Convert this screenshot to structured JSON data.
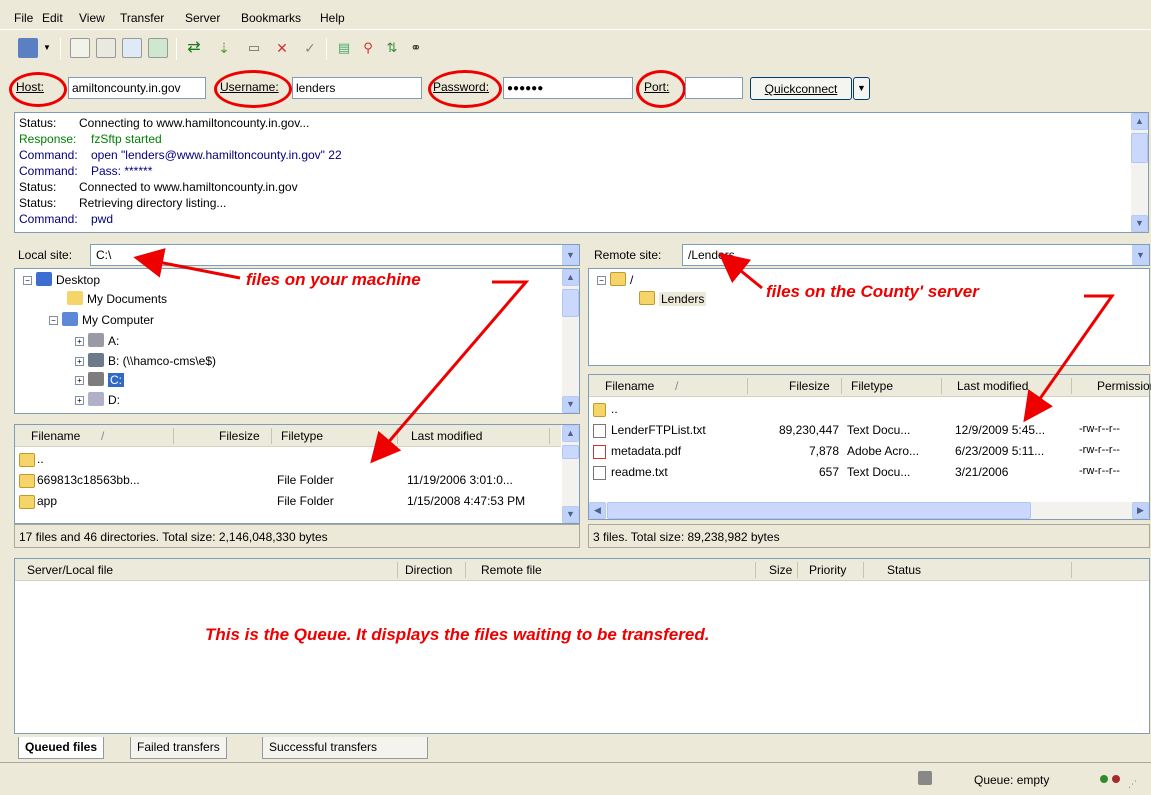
{
  "menu": [
    "File",
    "Edit",
    "View",
    "Transfer",
    "Server",
    "Bookmarks",
    "Help"
  ],
  "quickconnect": {
    "host_label": "Host:",
    "host_value": "amiltoncounty.in.gov",
    "username_label": "Username:",
    "username_value": "lenders",
    "password_label": "Password:",
    "password_value": "●●●●●●",
    "port_label": "Port:",
    "port_value": "",
    "button_label": "Quickconnect"
  },
  "log": [
    {
      "type": "Status:",
      "msg": "Connecting to www.hamiltoncounty.in.gov...",
      "color": "#000000"
    },
    {
      "type": "Response:",
      "msg": "fzSftp started",
      "color": "#008000"
    },
    {
      "type": "Command:",
      "msg": "open \"lenders@www.hamiltoncounty.in.gov\" 22",
      "color": "#000080"
    },
    {
      "type": "Command:",
      "msg": "Pass: ******",
      "color": "#000080"
    },
    {
      "type": "Status:",
      "msg": "Connected to www.hamiltoncounty.in.gov",
      "color": "#000000"
    },
    {
      "type": "Status:",
      "msg": "Retrieving directory listing...",
      "color": "#000000"
    },
    {
      "type": "Command:",
      "msg": "pwd",
      "color": "#000080"
    }
  ],
  "local": {
    "site_label": "Local site:",
    "path": "C:\\",
    "tree": [
      {
        "label": "Desktop",
        "icon": "desktop-icon"
      },
      {
        "label": "My Documents",
        "icon": "documents-folder-icon"
      },
      {
        "label": "My Computer",
        "icon": "computer-icon"
      },
      {
        "label": "A:",
        "icon": "floppy-drive-icon"
      },
      {
        "label": "B: (\\\\hamco-cms\\e$)",
        "icon": "network-drive-icon"
      },
      {
        "label": "C:",
        "icon": "hard-drive-icon"
      },
      {
        "label": "D:",
        "icon": "cd-drive-icon"
      }
    ],
    "headers": {
      "filename": "Filename",
      "sort": "/",
      "filesize": "Filesize",
      "filetype": "Filetype",
      "modified": "Last modified"
    },
    "files": [
      {
        "name": "..",
        "size": "",
        "type": "",
        "modified": ""
      },
      {
        "name": "669813c18563bb...",
        "size": "",
        "type": "File Folder",
        "modified": "11/19/2006 3:01:0..."
      },
      {
        "name": "app",
        "size": "",
        "type": "File Folder",
        "modified": "1/15/2008 4:47:53 PM"
      }
    ],
    "summary": "17 files and 46 directories. Total size: 2,146,048,330 bytes"
  },
  "remote": {
    "site_label": "Remote site:",
    "path": "/Lenders",
    "tree": [
      {
        "label": "/",
        "icon": "unknown-folder-icon"
      },
      {
        "label": "Lenders",
        "icon": "folder-icon"
      }
    ],
    "headers": {
      "filename": "Filename",
      "sort": "/",
      "filesize": "Filesize",
      "filetype": "Filetype",
      "modified": "Last modified",
      "permissions": "Permissions"
    },
    "files": [
      {
        "name": "..",
        "size": "",
        "type": "",
        "modified": "",
        "perm": ""
      },
      {
        "name": "LenderFTPList.txt",
        "size": "89,230,447",
        "type": "Text Docu...",
        "modified": "12/9/2009 5:45...",
        "perm": "-rw-r--r--"
      },
      {
        "name": "metadata.pdf",
        "size": "7,878",
        "type": "Adobe Acro...",
        "modified": "6/23/2009 5:11...",
        "perm": "-rw-r--r--"
      },
      {
        "name": "readme.txt",
        "size": "657",
        "type": "Text Docu...",
        "modified": "3/21/2006",
        "perm": "-rw-r--r--"
      }
    ],
    "summary": "3 files. Total size: 89,238,982 bytes"
  },
  "queue": {
    "headers": {
      "server_local": "Server/Local file",
      "direction": "Direction",
      "remote": "Remote file",
      "size": "Size",
      "priority": "Priority",
      "status": "Status"
    },
    "annotation": "This is the Queue.  It displays the files waiting to be transfered."
  },
  "tabs": [
    "Queued files",
    "Failed transfers",
    "Successful transfers"
  ],
  "statusbar": {
    "queue": "Queue: empty"
  },
  "annotations": {
    "local": "files on your machine",
    "remote": "files on the County' server"
  },
  "colors": {
    "annotation_red": "#e00000",
    "selection_blue": "#316ac5"
  }
}
